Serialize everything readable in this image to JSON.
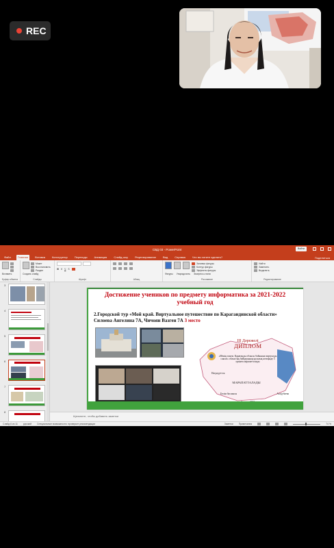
{
  "rec": {
    "label": "REC"
  },
  "powerpoint": {
    "title": "СВД 03 - PowerPoint",
    "signin": "Войти",
    "tabs": [
      "Файл",
      "Главная",
      "Вставка",
      "Конструктор",
      "Переходы",
      "Анимация",
      "Слайд-шоу",
      "Рецензирование",
      "Вид",
      "Справка",
      "Что вы хотите сделать?"
    ],
    "active_tab": "Главная",
    "share": "Поделиться",
    "ribbon": {
      "clipboard": {
        "paste": "Вставить",
        "label": "Буфер обмена"
      },
      "slides": {
        "new_slide": "Создать слайд",
        "layout": "Макет",
        "reset": "Восстановить",
        "section": "Раздел",
        "label": "Слайды"
      },
      "font": {
        "label": "Шрифт"
      },
      "paragraph": {
        "label": "Абзац"
      },
      "drawing": {
        "shapes": "Фигуры",
        "arrange": "Упорядочить",
        "quick_styles": "Экспресс-стили",
        "fill": "Заливка фигуры",
        "outline": "Контур фигуры",
        "effects": "Эффекты фигуры",
        "label": "Рисование"
      },
      "editing": {
        "find": "Найти",
        "replace": "Заменить",
        "select": "Выделить",
        "label": "Редактирование"
      }
    },
    "thumbnails": [
      "3",
      "4",
      "5",
      "6",
      "7",
      "8"
    ],
    "selected_thumbnail": "6",
    "slide": {
      "title": "Достижение учеников по предмету информатика за 2021-2022 учебный год",
      "subtitle_black": "2.Городской тур «Мой край. Виртуальное путешествие по Карагандинской области»   Силоева Ангелина 7А, Чичоян Вазген 7А",
      "subtitle_red": "3 место",
      "diploma": {
        "degree": "III Дәрежелі",
        "word": "ДИПЛОМ",
        "body": "«Менің өлкем. Қарағанды облысы бойынша виртуалды саяхат» облыстық байқауының қалалық кезеңінде 3 орынға марапатталады",
        "award": "Наградуется:",
        "marapat": "МАРАПАТТАЛАДЫ",
        "sign_left": "Бөлім басшысы",
        "sign_right": "Асадубаева",
        "date": "Заседан 2022"
      }
    },
    "notes_placeholder": "Щелкните, чтобы добавить заметки",
    "status": {
      "slide_counter": "Слайд 6 из 11",
      "language": "русский",
      "accessibility": "Специальные возможности: проверьте рекомендации",
      "notes": "Заметки",
      "comments": "Примечания",
      "zoom": "74 %"
    }
  }
}
